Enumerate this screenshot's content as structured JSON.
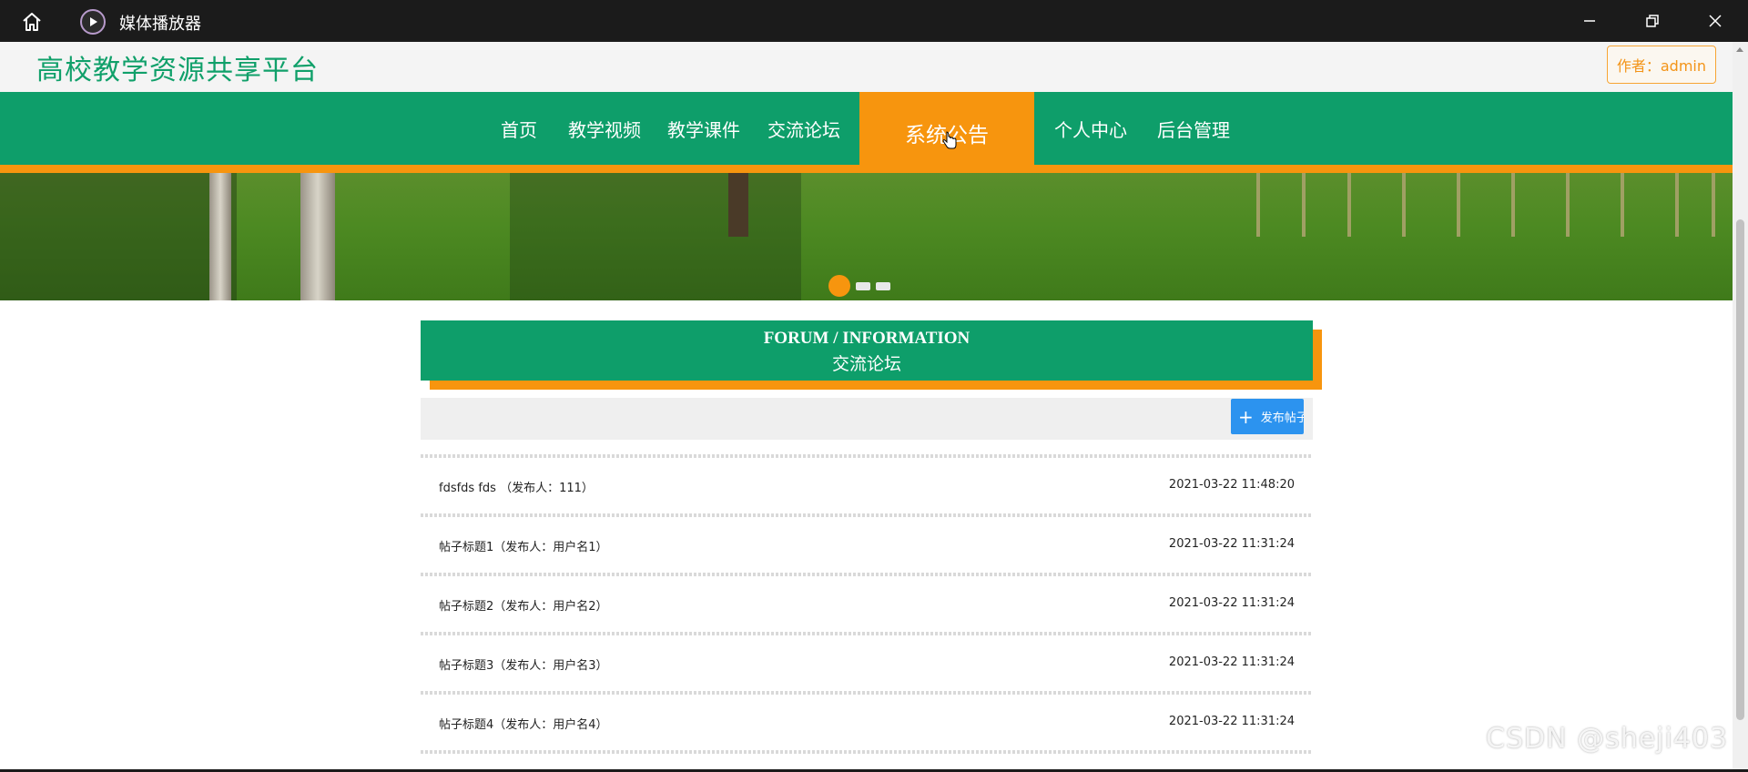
{
  "window": {
    "title": "媒体播放器",
    "home_icon": "home-icon",
    "app_icon": "media-player-icon",
    "controls": [
      "minimize-icon",
      "restore-icon",
      "close-icon"
    ]
  },
  "header": {
    "brand": "高校教学资源共享平台",
    "author": "作者：admin"
  },
  "nav": {
    "items": [
      {
        "label": "首页"
      },
      {
        "label": "教学视频"
      },
      {
        "label": "教学课件"
      },
      {
        "label": "交流论坛"
      },
      {
        "label": "系统公告",
        "active": true
      },
      {
        "label": "个人中心"
      },
      {
        "label": "后台管理"
      }
    ]
  },
  "colors": {
    "primary": "#0e9e6a",
    "accent": "#f7950e",
    "button": "#2c93ef"
  },
  "section": {
    "title_en": "FORUM / INFORMATION",
    "title_cn": "交流论坛",
    "post_button": "发布帖子"
  },
  "posts": [
    {
      "title": "fdsfds fds （发布人：111）",
      "date": "2021-03-22 11:48:20"
    },
    {
      "title": "帖子标题1（发布人：用户名1）",
      "date": "2021-03-22 11:31:24"
    },
    {
      "title": "帖子标题2（发布人：用户名2）",
      "date": "2021-03-22 11:31:24"
    },
    {
      "title": "帖子标题3（发布人：用户名3）",
      "date": "2021-03-22 11:31:24"
    },
    {
      "title": "帖子标题4（发布人：用户名4）",
      "date": "2021-03-22 11:31:24"
    }
  ],
  "watermark": "CSDN @sheji403"
}
